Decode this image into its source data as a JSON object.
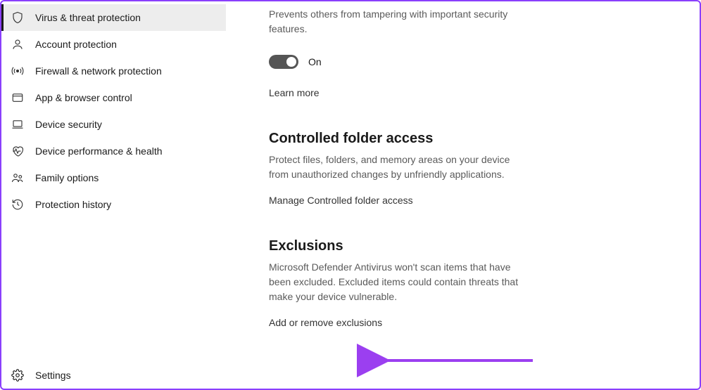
{
  "sidebar": {
    "items": [
      {
        "label": "Virus & threat protection",
        "active": true
      },
      {
        "label": "Account protection",
        "active": false
      },
      {
        "label": "Firewall & network protection",
        "active": false
      },
      {
        "label": "App & browser control",
        "active": false
      },
      {
        "label": "Device security",
        "active": false
      },
      {
        "label": "Device performance & health",
        "active": false
      },
      {
        "label": "Family options",
        "active": false
      },
      {
        "label": "Protection history",
        "active": false
      }
    ],
    "settings_label": "Settings"
  },
  "main": {
    "tamper": {
      "desc": "Prevents others from tampering with important security features.",
      "toggle_state": "On",
      "learn_more": "Learn more"
    },
    "cfa": {
      "title": "Controlled folder access",
      "desc": "Protect files, folders, and memory areas on your device from unauthorized changes by unfriendly applications.",
      "link": "Manage Controlled folder access"
    },
    "exclusions": {
      "title": "Exclusions",
      "desc": "Microsoft Defender Antivirus won't scan items that have been excluded. Excluded items could contain threats that make your device vulnerable.",
      "link": "Add or remove exclusions"
    }
  }
}
